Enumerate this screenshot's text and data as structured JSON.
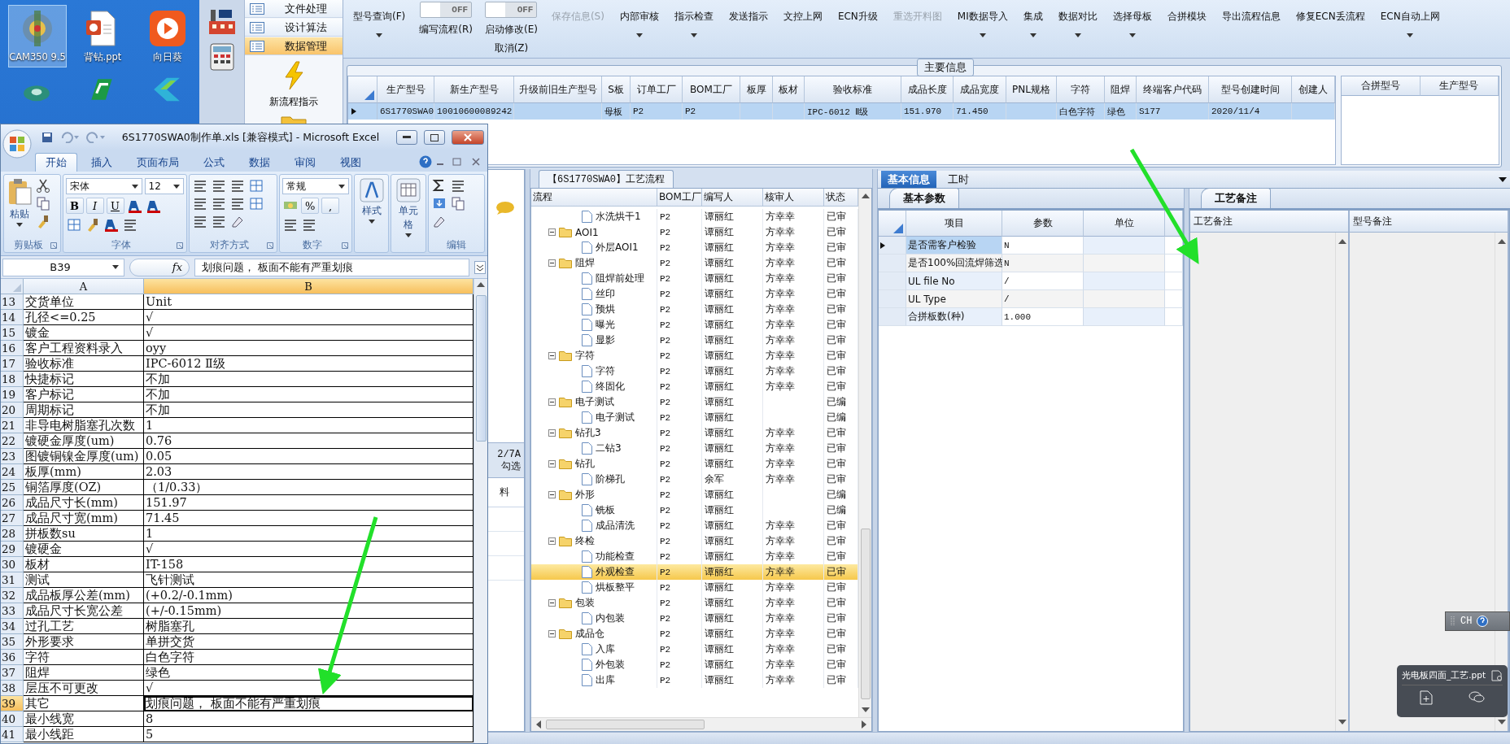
{
  "desktop": {
    "icons": [
      {
        "label": "CAM350 9.5",
        "selected": true
      },
      {
        "label": "背钻.ppt",
        "selected": false
      },
      {
        "label": "向日葵",
        "selected": false
      }
    ]
  },
  "app": {
    "nav": {
      "items": [
        {
          "label": "文件处理",
          "selected": false
        },
        {
          "label": "设计算法",
          "selected": false
        },
        {
          "label": "数据管理",
          "selected": true
        }
      ],
      "action": "新流程指示"
    },
    "toolbar": [
      {
        "kind": "button",
        "label": "型号查询(F)",
        "dropdown": true,
        "disabled": false
      },
      {
        "kind": "toggle",
        "on": false,
        "state_text": "OFF",
        "label": "编写流程(R)"
      },
      {
        "kind": "toggle",
        "on": false,
        "state_text": "OFF",
        "label": "启动修改(E)",
        "sublabel": "取消(Z)"
      },
      {
        "kind": "button",
        "label": "保存信息(S)",
        "dropdown": false,
        "disabled": true
      },
      {
        "kind": "button",
        "label": "内部审核",
        "dropdown": true,
        "disabled": false
      },
      {
        "kind": "button",
        "label": "指示检查",
        "dropdown": true,
        "disabled": false
      },
      {
        "kind": "button",
        "label": "发送指示",
        "dropdown": false,
        "disabled": false
      },
      {
        "kind": "button",
        "label": "文控上网",
        "dropdown": false,
        "disabled": false
      },
      {
        "kind": "button",
        "label": "ECN升级",
        "dropdown": false,
        "disabled": false
      },
      {
        "kind": "button",
        "label": "重选开料图",
        "dropdown": false,
        "disabled": true
      },
      {
        "kind": "button",
        "label": "MI数据导入",
        "dropdown": true,
        "disabled": false
      },
      {
        "kind": "button",
        "label": "集成",
        "dropdown": true,
        "disabled": false
      },
      {
        "kind": "button",
        "label": "数据对比",
        "dropdown": true,
        "disabled": false
      },
      {
        "kind": "button",
        "label": "选择母板",
        "dropdown": true,
        "disabled": false
      },
      {
        "kind": "button",
        "label": "合拼模块",
        "dropdown": false,
        "disabled": false
      },
      {
        "kind": "button",
        "label": "导出流程信息",
        "dropdown": false,
        "disabled": false
      },
      {
        "kind": "button",
        "label": "修复ECN丢流程",
        "dropdown": false,
        "disabled": false
      },
      {
        "kind": "button",
        "label": "ECN自动上网",
        "dropdown": true,
        "disabled": false
      }
    ],
    "main_info": {
      "title": "主要信息",
      "columns": [
        "生产型号",
        "新生产型号",
        "升级前旧生产型号",
        "S板",
        "订单工厂",
        "BOM工厂",
        "板厚",
        "板材",
        "验收标准",
        "成品长度",
        "成品宽度",
        "PNL规格",
        "字符",
        "阻焊",
        "终端客户代码",
        "型号创建时间",
        "创建人"
      ],
      "rows": [
        {
          "selected": true,
          "cells": [
            "6S1770SWA0",
            "10010600089242",
            null,
            "母板",
            "P2",
            "P2",
            null,
            null,
            "IPC-6012 Ⅱ级",
            "151.970",
            "71.450",
            null,
            "白色字符",
            "绿色",
            "S177",
            "2020/11/4",
            null
          ]
        }
      ],
      "side_columns": [
        "合拼型号",
        "生产型号"
      ]
    },
    "left_panel": {
      "texts": [
        "2/7A",
        "勾选",
        "料"
      ]
    },
    "flow": {
      "title": "【6S1770SWA0】工艺流程",
      "columns": [
        "流程",
        "BOM工厂",
        "编写人",
        "核审人",
        "状态"
      ],
      "items": [
        {
          "kind": "step",
          "name": "水洗烘干1",
          "factory": "P2",
          "writer": "谭丽红",
          "reviewer": "方幸幸",
          "status": "已审",
          "selected": false
        },
        {
          "kind": "group",
          "name": "AOI1",
          "factory": "P2",
          "writer": "谭丽红",
          "reviewer": "方幸幸",
          "status": "已审",
          "selected": false,
          "children": [
            {
              "kind": "step",
              "name": "外层AOI1",
              "factory": "P2",
              "writer": "谭丽红",
              "reviewer": "方幸幸",
              "status": "已审",
              "selected": false
            }
          ]
        },
        {
          "kind": "group",
          "name": "阻焊",
          "factory": "P2",
          "writer": "谭丽红",
          "reviewer": "方幸幸",
          "status": "已审",
          "selected": false,
          "children": [
            {
              "kind": "step",
              "name": "阻焊前处理",
              "factory": "P2",
              "writer": "谭丽红",
              "reviewer": "方幸幸",
              "status": "已审",
              "selected": false
            },
            {
              "kind": "step",
              "name": "丝印",
              "factory": "P2",
              "writer": "谭丽红",
              "reviewer": "方幸幸",
              "status": "已审",
              "selected": false
            },
            {
              "kind": "step",
              "name": "预烘",
              "factory": "P2",
              "writer": "谭丽红",
              "reviewer": "方幸幸",
              "status": "已审",
              "selected": false
            },
            {
              "kind": "step",
              "name": "曝光",
              "factory": "P2",
              "writer": "谭丽红",
              "reviewer": "方幸幸",
              "status": "已审",
              "selected": false
            },
            {
              "kind": "step",
              "name": "显影",
              "factory": "P2",
              "writer": "谭丽红",
              "reviewer": "方幸幸",
              "status": "已审",
              "selected": false
            }
          ]
        },
        {
          "kind": "group",
          "name": "字符",
          "factory": "P2",
          "writer": "谭丽红",
          "reviewer": "方幸幸",
          "status": "已审",
          "selected": false,
          "children": [
            {
              "kind": "step",
              "name": "字符",
              "factory": "P2",
              "writer": "谭丽红",
              "reviewer": "方幸幸",
              "status": "已审",
              "selected": false
            },
            {
              "kind": "step",
              "name": "终固化",
              "factory": "P2",
              "writer": "谭丽红",
              "reviewer": "方幸幸",
              "status": "已审",
              "selected": false
            }
          ]
        },
        {
          "kind": "group",
          "name": "电子测试",
          "factory": "P2",
          "writer": "谭丽红",
          "status": "已编",
          "selected": false,
          "children": [
            {
              "kind": "step",
              "name": "电子测试",
              "factory": "P2",
              "writer": "谭丽红",
              "status": "已编",
              "selected": false
            }
          ]
        },
        {
          "kind": "group",
          "name": "钻孔3",
          "factory": "P2",
          "writer": "谭丽红",
          "reviewer": "方幸幸",
          "status": "已审",
          "selected": false,
          "children": [
            {
              "kind": "step",
              "name": "二钻3",
              "factory": "P2",
              "writer": "谭丽红",
              "reviewer": "方幸幸",
              "status": "已审",
              "selected": false
            }
          ]
        },
        {
          "kind": "group",
          "name": "钻孔",
          "factory": "P2",
          "writer": "谭丽红",
          "reviewer": "方幸幸",
          "status": "已审",
          "selected": false,
          "children": [
            {
              "kind": "step",
              "name": "阶梯孔",
              "factory": "P2",
              "writer": "余军",
              "reviewer": "方幸幸",
              "status": "已审",
              "selected": false
            }
          ]
        },
        {
          "kind": "group",
          "name": "外形",
          "factory": "P2",
          "writer": "谭丽红",
          "status": "已编",
          "selected": false,
          "children": [
            {
              "kind": "step",
              "name": "铣板",
              "factory": "P2",
              "writer": "谭丽红",
              "status": "已编",
              "selected": false
            },
            {
              "kind": "step",
              "name": "成品清洗",
              "factory": "P2",
              "writer": "谭丽红",
              "reviewer": "方幸幸",
              "status": "已审",
              "selected": false
            }
          ]
        },
        {
          "kind": "group",
          "name": "终检",
          "factory": "P2",
          "writer": "谭丽红",
          "reviewer": "方幸幸",
          "status": "已审",
          "selected": false,
          "children": [
            {
              "kind": "step",
              "name": "功能检查",
              "factory": "P2",
              "writer": "谭丽红",
              "reviewer": "方幸幸",
              "status": "已审",
              "selected": false
            },
            {
              "kind": "step",
              "name": "外观检查",
              "factory": "P2",
              "writer": "谭丽红",
              "reviewer": "方幸幸",
              "status": "已审",
              "selected": true
            },
            {
              "kind": "step",
              "name": "烘板整平",
              "factory": "P2",
              "writer": "谭丽红",
              "reviewer": "方幸幸",
              "status": "已审",
              "selected": false
            }
          ]
        },
        {
          "kind": "group",
          "name": "包装",
          "factory": "P2",
          "writer": "谭丽红",
          "reviewer": "方幸幸",
          "status": "已审",
          "selected": false,
          "children": [
            {
              "kind": "step",
              "name": "内包装",
              "factory": "P2",
              "writer": "谭丽红",
              "reviewer": "方幸幸",
              "status": "已审",
              "selected": false
            }
          ]
        },
        {
          "kind": "group",
          "name": "成品仓",
          "factory": "P2",
          "writer": "谭丽红",
          "reviewer": "方幸幸",
          "status": "已审",
          "selected": false,
          "children": [
            {
              "kind": "step",
              "name": "入库",
              "factory": "P2",
              "writer": "谭丽红",
              "reviewer": "方幸幸",
              "status": "已审",
              "selected": false
            },
            {
              "kind": "step",
              "name": "外包装",
              "factory": "P2",
              "writer": "谭丽红",
              "reviewer": "方幸幸",
              "status": "已审",
              "selected": false
            },
            {
              "kind": "step",
              "name": "出库",
              "factory": "P2",
              "writer": "谭丽红",
              "reviewer": "方幸幸",
              "status": "已审",
              "selected": false
            }
          ]
        }
      ]
    },
    "details": {
      "tabs": [
        {
          "label": "基本信息",
          "selected": true
        },
        {
          "label": "工时",
          "selected": false
        }
      ],
      "params": {
        "tab": "基本参数",
        "columns": [
          "项目",
          "参数",
          "单位"
        ],
        "rows": [
          {
            "item": "是否需客户检验",
            "value": "N",
            "selected": true
          },
          {
            "item": "是否100%回流焊筛选",
            "value": "N",
            "selected": false
          },
          {
            "item": "UL file No",
            "value": "/",
            "selected": false
          },
          {
            "item": "UL Type",
            "value": "/",
            "selected": false
          },
          {
            "item": "合拼板数(种)",
            "value": "1.000",
            "selected": false
          }
        ]
      },
      "remarks": {
        "tab": "工艺备注",
        "columns": [
          "工艺备注",
          "型号备注"
        ]
      }
    }
  },
  "excel": {
    "title": "6S1770SWA0制作单.xls  [兼容模式] - Microsoft Excel",
    "tabs": [
      {
        "label": "开始",
        "selected": true
      },
      {
        "label": "插入",
        "selected": false
      },
      {
        "label": "页面布局",
        "selected": false
      },
      {
        "label": "公式",
        "selected": false
      },
      {
        "label": "数据",
        "selected": false
      },
      {
        "label": "审阅",
        "selected": false
      },
      {
        "label": "视图",
        "selected": false
      }
    ],
    "ribbon": {
      "paste": "粘贴",
      "font_name": "宋体",
      "font_size": "12",
      "format_buttons": [
        "B",
        "I",
        "U"
      ],
      "number_format": "常规",
      "number_buttons": [
        "%",
        ","
      ],
      "styles": "样式",
      "cells": "单元格",
      "groups": [
        "剪贴板",
        "字体",
        "对齐方式",
        "数字",
        "编辑"
      ]
    },
    "name_box": "B39",
    "function_label": "fx",
    "formula": "划痕问题，  板面不能有严重划痕",
    "columns": [
      {
        "label": "A",
        "selected": false
      },
      {
        "label": "B",
        "selected": true
      }
    ],
    "rows": [
      {
        "num": "13",
        "a": "交货单位",
        "b": "Unit",
        "selected": false
      },
      {
        "num": "14",
        "a": "孔径<=0.25",
        "b": "√",
        "selected": false
      },
      {
        "num": "15",
        "a": "镀金",
        "b": "√",
        "selected": false
      },
      {
        "num": "16",
        "a": "客户工程资料录入",
        "b": "oyy",
        "selected": false
      },
      {
        "num": "17",
        "a": "验收标准",
        "b": "IPC-6012  Ⅱ级",
        "selected": false
      },
      {
        "num": "18",
        "a": "快捷标记",
        "b": "不加",
        "selected": false
      },
      {
        "num": "19",
        "a": "客户标记",
        "b": "不加",
        "selected": false
      },
      {
        "num": "20",
        "a": "周期标记",
        "b": "不加",
        "selected": false
      },
      {
        "num": "21",
        "a": "非导电树脂塞孔次数",
        "b": "1",
        "selected": false
      },
      {
        "num": "22",
        "a": "镀硬金厚度(um)",
        "b": "0.76",
        "selected": false
      },
      {
        "num": "23",
        "a": "图镀铜镍金厚度(um)",
        "b": "0.05",
        "selected": false
      },
      {
        "num": "24",
        "a": "板厚(mm)",
        "b": "2.03",
        "selected": false
      },
      {
        "num": "25",
        "a": "铜箔厚度(OZ)",
        "b": "（1/0.33）",
        "selected": false
      },
      {
        "num": "26",
        "a": "成品尺寸长(mm)",
        "b": "151.97",
        "selected": false
      },
      {
        "num": "27",
        "a": "成品尺寸宽(mm)",
        "b": "71.45",
        "selected": false
      },
      {
        "num": "28",
        "a": "拼板数su",
        "b": "1",
        "selected": false
      },
      {
        "num": "29",
        "a": "镀硬金",
        "b": "√",
        "selected": false
      },
      {
        "num": "30",
        "a": "板材",
        "b": "IT-158",
        "selected": false
      },
      {
        "num": "31",
        "a": "测试",
        "b": "飞针测试",
        "selected": false
      },
      {
        "num": "32",
        "a": "成品板厚公差(mm)",
        "b": "(+0.2/-0.1mm)",
        "selected": false
      },
      {
        "num": "33",
        "a": "成品尺寸长宽公差",
        "b": "(+/-0.15mm)",
        "selected": false
      },
      {
        "num": "34",
        "a": "过孔工艺",
        "b": "树脂塞孔",
        "selected": false
      },
      {
        "num": "35",
        "a": "外形要求",
        "b": "单拼交货",
        "selected": false
      },
      {
        "num": "36",
        "a": "字符",
        "b": "白色字符",
        "selected": false
      },
      {
        "num": "37",
        "a": "阻焊",
        "b": "绿色",
        "selected": false
      },
      {
        "num": "38",
        "a": "层压不可更改",
        "b": "√",
        "selected": false
      },
      {
        "num": "39",
        "a": "其它",
        "b": "划痕问题，  板面不能有严重划痕",
        "selected": true
      },
      {
        "num": "40",
        "a": "最小线宽",
        "b": "8",
        "selected": false
      },
      {
        "num": "41",
        "a": "最小线距",
        "b": "5",
        "selected": false
      }
    ]
  },
  "language_bar": {
    "label": "CH"
  },
  "notification": {
    "title": "光电板四面_工艺.ppt"
  }
}
